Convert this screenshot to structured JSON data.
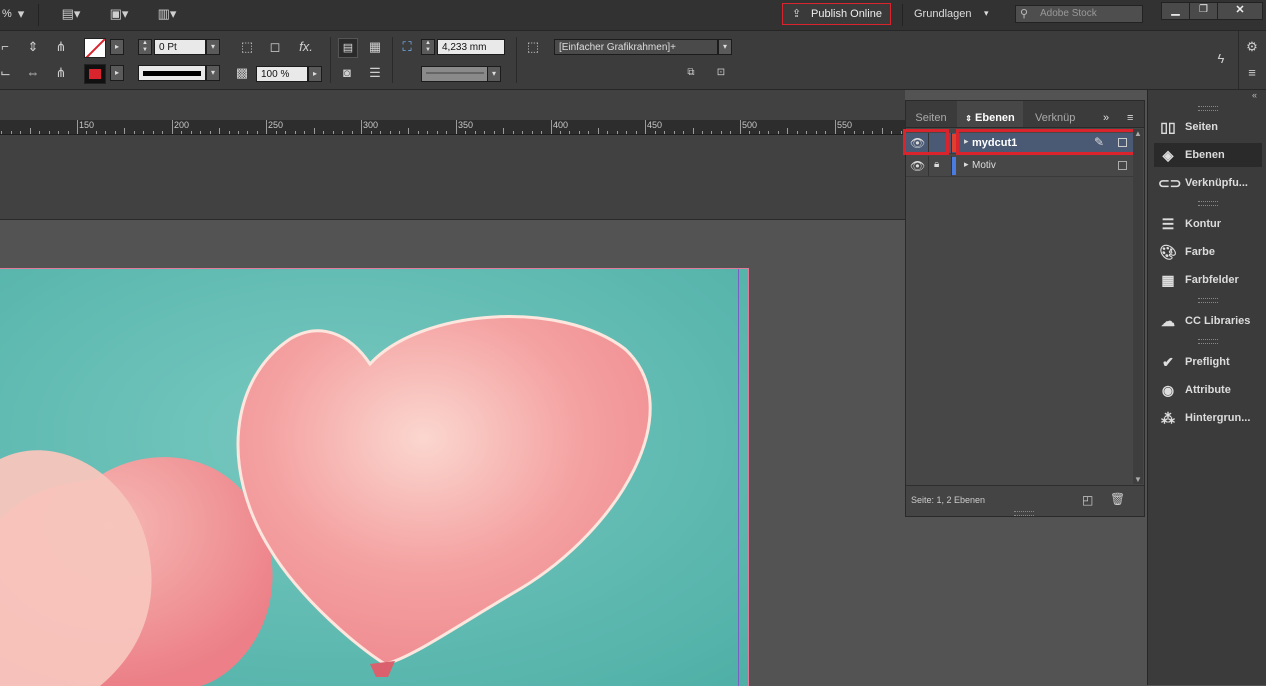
{
  "appbar": {
    "zoom_partial": "%",
    "publish_label": "Publish Online",
    "workspace_label": "Grundlagen",
    "search_placeholder": "Adobe Stock"
  },
  "control": {
    "stroke_weight": "0 Pt",
    "opacity": "100 %",
    "offset_value": "4,233 mm",
    "object_style": "[Einfacher Grafikrahmen]+"
  },
  "ruler": {
    "labels": [
      "150",
      "200",
      "250",
      "300",
      "350",
      "400",
      "450",
      "500",
      "550"
    ]
  },
  "layers_panel": {
    "tabs": [
      "Seiten",
      "Ebenen",
      "Verknüp"
    ],
    "layers": [
      {
        "name": "mydcut1",
        "color": "#e0402e",
        "visible": true,
        "locked": false,
        "selected": true
      },
      {
        "name": "Motiv",
        "color": "#4a7be0",
        "visible": true,
        "locked": true,
        "selected": false
      }
    ],
    "footer_status": "Seite: 1, 2 Ebenen"
  },
  "dock": {
    "items": [
      {
        "label": "Seiten",
        "icon": "pages-icon"
      },
      {
        "label": "Ebenen",
        "icon": "layers-icon"
      },
      {
        "label": "Verknüpfu...",
        "icon": "links-icon"
      },
      {
        "label": "Kontur",
        "icon": "stroke-icon"
      },
      {
        "label": "Farbe",
        "icon": "color-icon"
      },
      {
        "label": "Farbfelder",
        "icon": "swatches-icon"
      },
      {
        "label": "CC Libraries",
        "icon": "cc-libraries-icon"
      },
      {
        "label": "Preflight",
        "icon": "preflight-icon"
      },
      {
        "label": "Attribute",
        "icon": "attributes-icon"
      },
      {
        "label": "Hintergrun...",
        "icon": "background-tasks-icon"
      }
    ]
  },
  "colors": {
    "highlight": "#d9232d",
    "artwork_bg": "#5ab9b0",
    "balloon": "#f29a9c"
  }
}
